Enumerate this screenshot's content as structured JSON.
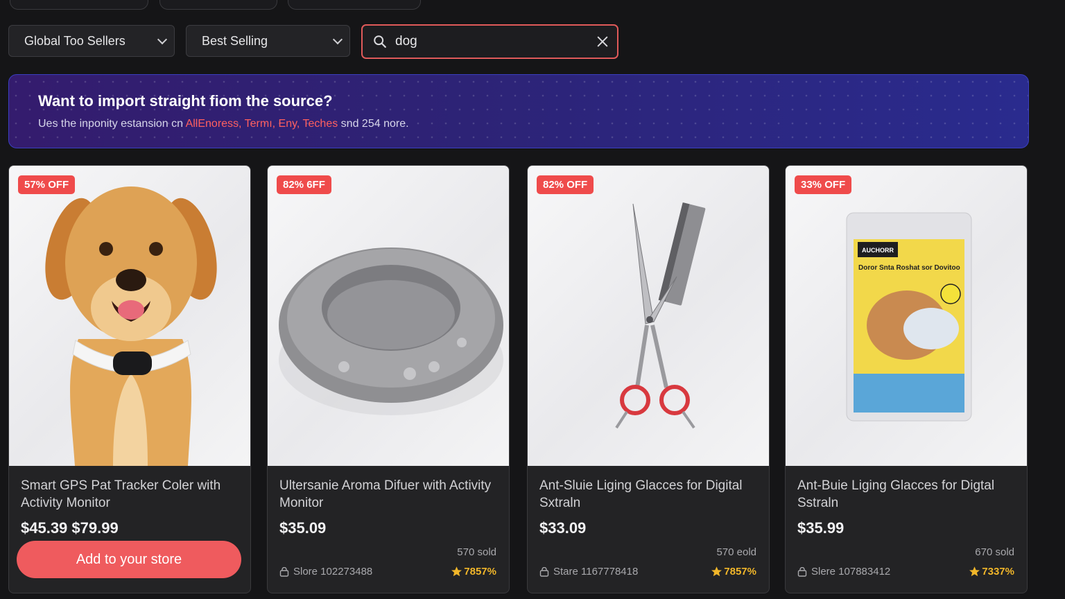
{
  "filters": {
    "region": "Global Too Sellers",
    "sort": "Best Selling"
  },
  "search": {
    "value": "dog"
  },
  "banner": {
    "title": "Want to import straight fiom the source?",
    "text_before": "Ues the inponity estansion cn ",
    "sources": "AllEnoress, Termı, Eny, Teches",
    "text_after": " snd 254 nore."
  },
  "products": [
    {
      "badge": "57% OFF",
      "title": "Smart GPS Pat Tracker Coler with Activity Monitor",
      "price": "$45.39 $79.99",
      "button": "Add to your store"
    },
    {
      "badge": "82% 6FF",
      "title": "Ultersanie Aroma Difuer with Activity Monitor",
      "price": "$35.09",
      "sold": "570 sold",
      "store": "Slore 102273488",
      "rating": "7857%"
    },
    {
      "badge": "82% OFF",
      "title": "Ant-Sluie Liging Glacces for Digital Sxtraln",
      "price": "$33.09",
      "sold": "570 eold",
      "store": "Stare 1167778418",
      "rating": "7857%"
    },
    {
      "badge": "33% OFF",
      "title": "Ant-Buie Liging Glacces for Digtal Sstraln",
      "price": "$35.99",
      "sold": "670 sold",
      "store": "Slere 107883412",
      "rating": "7337%",
      "package": {
        "brand": "AUCHORR",
        "headline": "Doror Snta Roshat sor Dovitoo"
      }
    }
  ],
  "colors": {
    "accent": "#ef4b4b",
    "rating": "#f1b62a",
    "banner": "#2d2376"
  }
}
